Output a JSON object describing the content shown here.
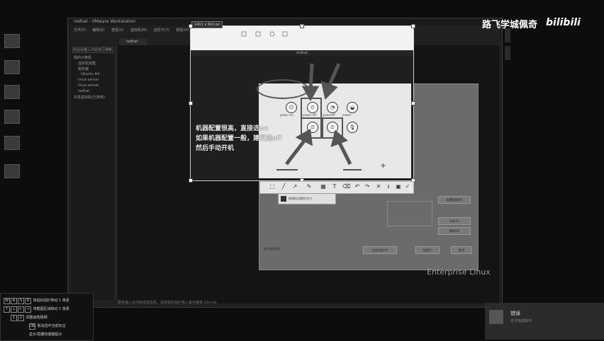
{
  "desktop": {
    "icons": [
      "",
      "",
      "",
      "",
      "",
      ""
    ]
  },
  "vmware": {
    "title": "redhat - VMware Workstation",
    "menu": [
      "文件(F)",
      "编辑(E)",
      "查看(V)",
      "虚拟机(M)",
      "选项卡(T)",
      "帮助(H)"
    ],
    "tab": "redhat",
    "library": {
      "search": "在此处键入内容进行搜索",
      "nodes": [
        "我的计算机",
        "虚拟机克隆",
        "服务器",
        "Ubuntu 64",
        "linux server",
        "linux server",
        "redhat",
        "共享虚拟机(已弃用)"
      ]
    },
    "statusbar": "要将输入定向到该虚拟机，请将鼠标指针移入其中或按 Ctrl+G。"
  },
  "capture": {
    "size": "1411 x 910 px",
    "inner_title": "redhat",
    "annotation_lines": [
      "机器配置很高，直接选on",
      "如果机器配置一般，建议选off",
      "然后手动开机"
    ]
  },
  "panel": {
    "options": [
      {
        "symbol": "⏻",
        "label": "power on"
      },
      {
        "symbol": "⏲",
        "label": "power off"
      },
      {
        "symbol": "◔",
        "label": "poweroff"
      },
      {
        "symbol": "◒",
        "label": "power"
      },
      {
        "symbol": "⏲",
        "label": ""
      },
      {
        "symbol": "⏲",
        "label": ""
      },
      {
        "symbol": "🎙",
        "label": ""
      }
    ]
  },
  "toolbar": {
    "tools": [
      "⬚",
      "╱",
      "↗",
      "✎",
      "▦",
      "T",
      "⌫",
      "↶",
      "↷",
      "✕",
      "⭳",
      "▣",
      "✓"
    ],
    "color_label": "修改标注颜色/大小"
  },
  "installer": {
    "buttons": [
      "配置网络(R)",
      "文件(F)",
      "删除(D)"
    ],
    "bottom_buttons": [
      "自动分区(A)",
      "完成(F)",
      "取消"
    ],
    "checkbox_label": "显示所有分区",
    "brand": "Enterprise Linux"
  },
  "hotkeys": [
    {
      "keys": [
        "W",
        "A",
        "S",
        "D"
      ],
      "text": "将鼠标指针移动 1 像素"
    },
    {
      "keys": [
        "↑",
        "↓",
        "←",
        "→"
      ],
      "text": "将截图区域移动 1 像素"
    },
    {
      "keys": [
        "1",
        "2"
      ],
      "text": "调整画笔粗细"
    },
    {
      "keys": [
        "⌫"
      ],
      "text": "取消选中当前标注"
    },
    {
      "keys": [],
      "text": "显示/隐藏快捷键提示"
    }
  ],
  "toast": {
    "title": "错误",
    "message": "无法完成操作"
  },
  "logo": {
    "cn": "路飞学城佩奇",
    "bili": "bilibili"
  }
}
